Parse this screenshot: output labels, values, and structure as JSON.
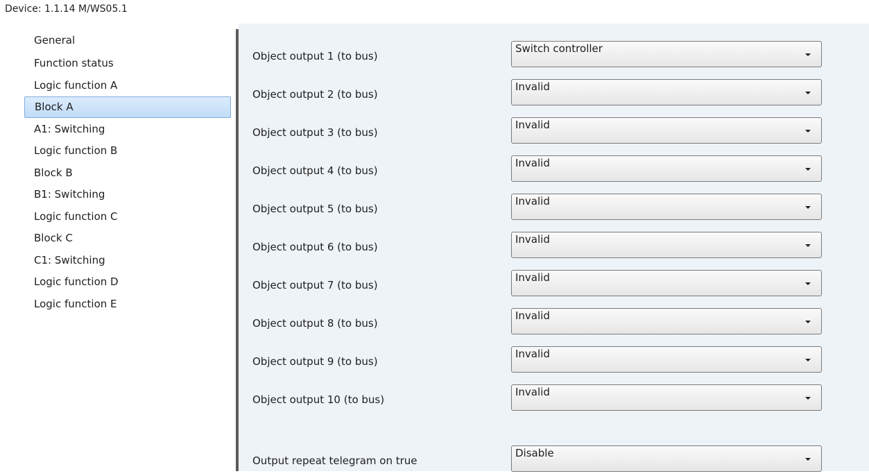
{
  "device": {
    "title": "Device: 1.1.14  M/WS05.1"
  },
  "sidebar": {
    "items": [
      {
        "label": "General"
      },
      {
        "label": "Function status"
      },
      {
        "label": "Logic function A"
      },
      {
        "label": "Block A",
        "selected": true
      },
      {
        "label": "A1: Switching"
      },
      {
        "label": "Logic function B"
      },
      {
        "label": "Block B"
      },
      {
        "label": "B1: Switching"
      },
      {
        "label": "Logic function C"
      },
      {
        "label": "Block C"
      },
      {
        "label": "C1: Switching"
      },
      {
        "label": "Logic function D"
      },
      {
        "label": "Logic function E"
      }
    ]
  },
  "params": [
    {
      "label": "Object output 1 (to bus)",
      "value": "Switch controller"
    },
    {
      "label": "Object output 2 (to bus)",
      "value": "Invalid"
    },
    {
      "label": "Object output 3 (to bus)",
      "value": "Invalid"
    },
    {
      "label": "Object output 4 (to bus)",
      "value": "Invalid"
    },
    {
      "label": "Object output 5 (to bus)",
      "value": "Invalid"
    },
    {
      "label": "Object output 6 (to bus)",
      "value": "Invalid"
    },
    {
      "label": "Object output 7 (to bus)",
      "value": "Invalid"
    },
    {
      "label": "Object output 8 (to bus)",
      "value": "Invalid"
    },
    {
      "label": "Object output 9 (to bus)",
      "value": "Invalid"
    },
    {
      "label": "Object output 10 (to bus)",
      "value": "Invalid"
    },
    {
      "label": "Output repeat telegram on true",
      "value": "Disable"
    }
  ],
  "colors": {
    "selection": "#c8e0f8",
    "panel_background": "#eef3f8",
    "divider": "#5b5b5b"
  }
}
